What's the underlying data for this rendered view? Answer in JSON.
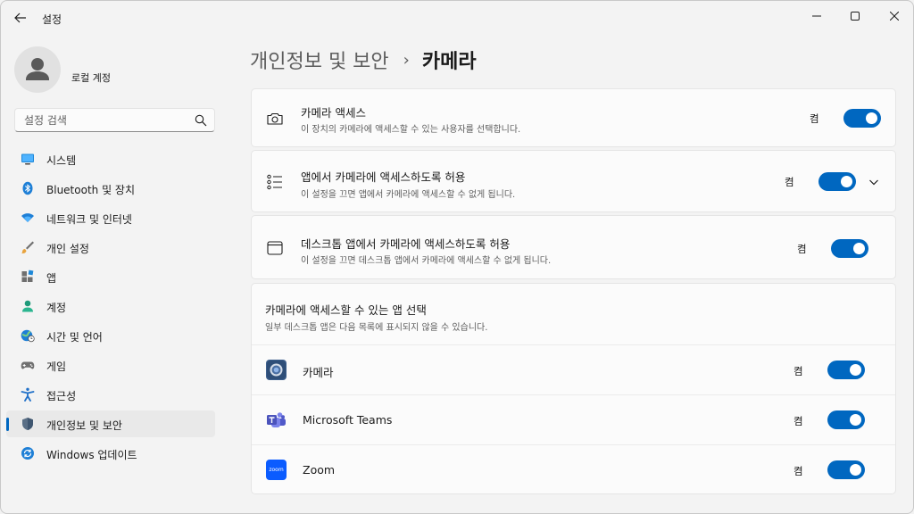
{
  "window": {
    "title": "설정"
  },
  "profile": {
    "name": "로컬 계정"
  },
  "search": {
    "placeholder": "설정 검색"
  },
  "sidebar": {
    "items": [
      {
        "label": "시스템",
        "icon": "system-icon"
      },
      {
        "label": "Bluetooth 및 장치",
        "icon": "bluetooth-icon"
      },
      {
        "label": "네트워크 및 인터넷",
        "icon": "network-icon"
      },
      {
        "label": "개인 설정",
        "icon": "personalization-icon"
      },
      {
        "label": "앱",
        "icon": "apps-icon"
      },
      {
        "label": "계정",
        "icon": "accounts-icon"
      },
      {
        "label": "시간 및 언어",
        "icon": "time-language-icon"
      },
      {
        "label": "게임",
        "icon": "gaming-icon"
      },
      {
        "label": "접근성",
        "icon": "accessibility-icon"
      },
      {
        "label": "개인정보 및 보안",
        "icon": "privacy-shield-icon",
        "selected": true
      },
      {
        "label": "Windows 업데이트",
        "icon": "windows-update-icon"
      }
    ]
  },
  "breadcrumb": {
    "parent": "개인정보 및 보안",
    "separator": "›",
    "current": "카메라"
  },
  "settings": {
    "camera_access": {
      "title": "카메라 액세스",
      "description": "이 장치의 카메라에 액세스할 수 있는 사용자를 선택합니다.",
      "state": "켬",
      "on": true
    },
    "apps_access": {
      "title": "앱에서 카메라에 액세스하도록 허용",
      "description": "이 설정을 끄면 앱에서 카메라에 액세스할 수 없게 됩니다.",
      "state": "켬",
      "on": true
    },
    "desktop_apps_access": {
      "title": "데스크톱 앱에서 카메라에 액세스하도록 허용",
      "description": "이 설정을 끄면 데스크톱 앱에서 카메라에 액세스할 수 없게 됩니다.",
      "state": "켬",
      "on": true
    }
  },
  "app_section": {
    "title": "카메라에 액세스할 수 있는 앱 선택",
    "description": "일부 데스크톱 앱은 다음 목록에 표시되지 않을 수 있습니다.",
    "apps": [
      {
        "name": "카메라",
        "state": "켬",
        "on": true,
        "icon": "camera-app-icon"
      },
      {
        "name": "Microsoft Teams",
        "state": "켬",
        "on": true,
        "icon": "teams-icon"
      },
      {
        "name": "Zoom",
        "state": "켬",
        "on": true,
        "icon": "zoom-icon",
        "icon_text": "zoom"
      }
    ]
  },
  "colors": {
    "accent": "#0067c0",
    "background": "#f3f3f3",
    "card": "#fbfbfb"
  }
}
